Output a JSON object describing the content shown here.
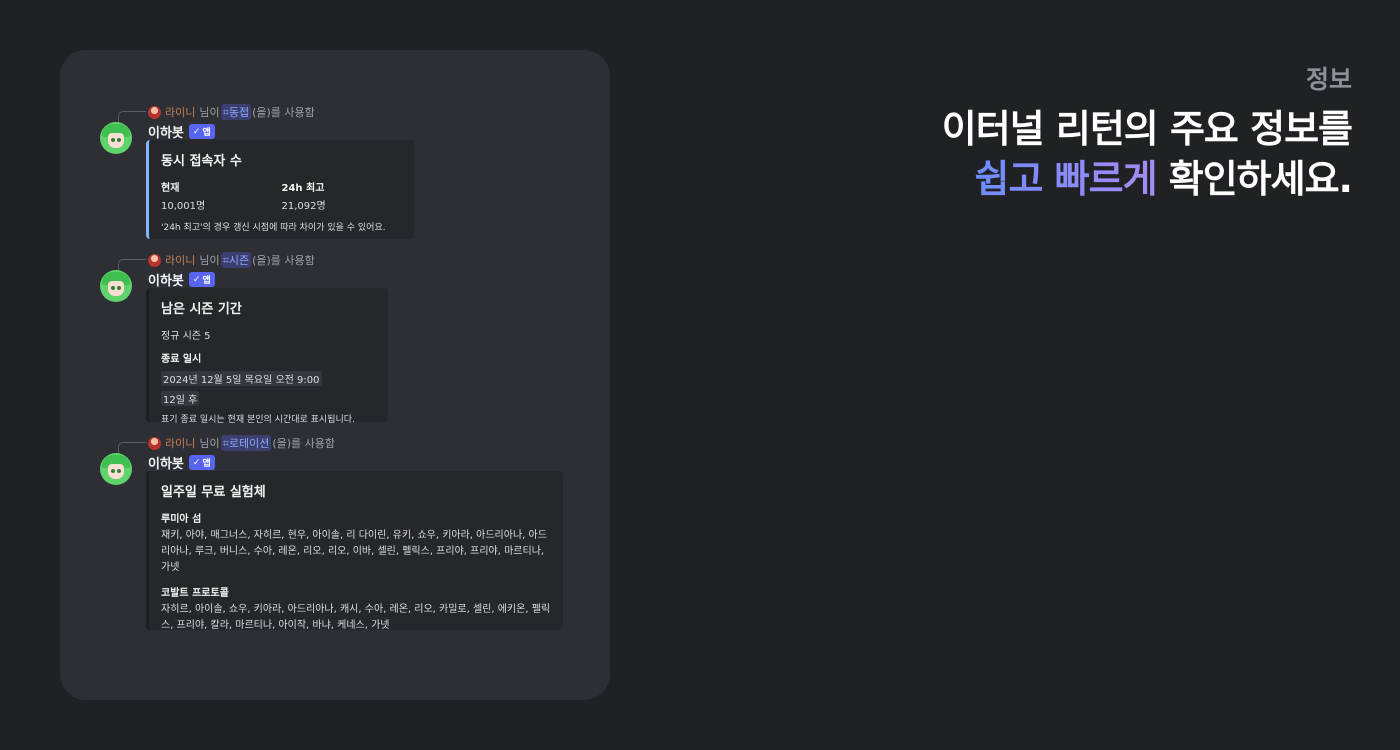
{
  "info_label": "정보",
  "headline": {
    "line1": "이터널 리턴의 주요 정보를",
    "highlight": "쉽고 빠르게",
    "line2_rest": " 확인하세요."
  },
  "messages": [
    {
      "reply_user": "라이니",
      "reply_mid": " 님이 ",
      "command": "동접",
      "reply_end": "(을)를 사용함",
      "author": "이하봇",
      "badge": "앱",
      "embed": {
        "title": "동시 접속자 수",
        "fields": [
          {
            "name": "현재",
            "value": "10,001명"
          },
          {
            "name": "24h 최고",
            "value": "21,092명"
          }
        ],
        "footer": "'24h 최고'의 경우 갱신 시점에 따라 차이가 있을 수 있어요."
      }
    },
    {
      "reply_user": "라이니",
      "reply_mid": " 님이 ",
      "command": "시즌",
      "reply_end": "(을)를 사용함",
      "author": "이하봇",
      "badge": "앱",
      "embed": {
        "title": "남은 시즌 기간",
        "desc": "정규 시즌 5",
        "field_name": "종료 일시",
        "date": "2024년 12월 5일 목요일 오전 9:00",
        "relative": "12일 후",
        "footer": "표기 종료 일시는 현재 본인의 시간대로 표시됩니다."
      }
    },
    {
      "reply_user": "라이니",
      "reply_mid": " 님이 ",
      "command": "로테이션",
      "reply_end": "(을)를 사용함",
      "author": "이하봇",
      "badge": "앱",
      "embed": {
        "title": "일주일 무료 실험체",
        "sections": [
          {
            "name": "루미아 섬",
            "value": "재키, 아야, 매그너스, 자히르, 현우, 아이솔, 리 다이린, 유키, 쇼우, 키아라, 아드리아나, 아드리아나, 루크, 버니스, 수아, 레온, 리오, 리오, 이바, 셀린, 펠릭스, 프리야, 프리야, 마르티나, 가넷"
          },
          {
            "name": "코발트 프로토콜",
            "value": "자히르, 아이솔, 쇼우, 키아라, 아드리아나, 캐시, 수아, 레온, 리오, 카밀로, 셀린, 에키온, 펠릭스, 프리야, 칼라, 마르티나, 아이작, 바냐, 케네스, 가넷"
          }
        ]
      }
    }
  ],
  "colors": {
    "background": "#1f2124",
    "panel": "#2e2f34",
    "accent_gradient_start": "#6e8cff",
    "accent_gradient_end": "#a68bf2"
  }
}
